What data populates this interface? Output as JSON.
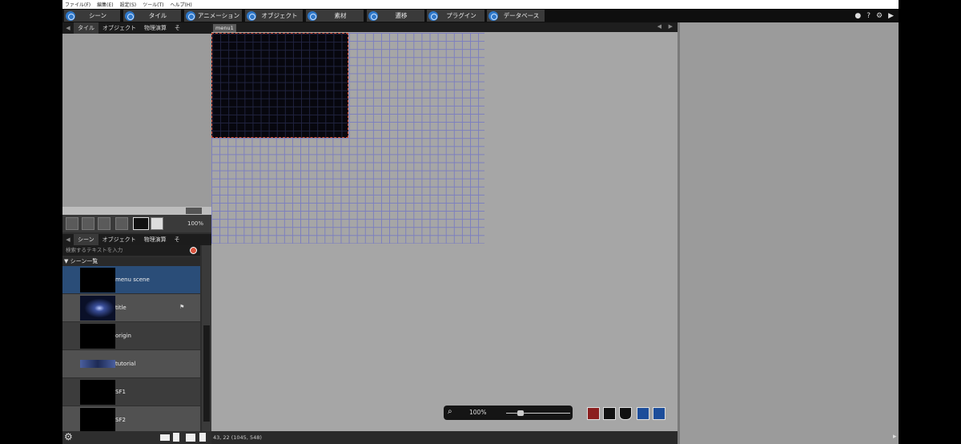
{
  "menu": [
    "ファイル(F)",
    "編集(E)",
    "設定(S)",
    "ツール(T)",
    "ヘルプ(H)"
  ],
  "main_tabs": [
    {
      "label": "シーン",
      "icon": "scene-icon"
    },
    {
      "label": "タイル",
      "icon": "tile-icon"
    },
    {
      "label": "アニメーション",
      "icon": "animation-icon"
    },
    {
      "label": "オブジェクト",
      "icon": "object-icon"
    },
    {
      "label": "素材",
      "icon": "resource-icon"
    },
    {
      "label": "遷移",
      "icon": "transition-icon"
    },
    {
      "label": "プラグイン",
      "icon": "plugin-icon"
    },
    {
      "label": "データベース",
      "icon": "database-icon"
    }
  ],
  "top_right": {
    "help": "?",
    "play": "▶"
  },
  "upper_tabs": [
    "タイル",
    "オブジェクト",
    "物理演算",
    "そ"
  ],
  "zoom_tiles": "100%",
  "lower_tabs": [
    "シーン",
    "オブジェクト",
    "物理演算",
    "そ"
  ],
  "search_placeholder": "検索するテキストを入力",
  "scene_list_title": "シーン一覧",
  "scenes": [
    {
      "name": "menu scene",
      "selected": true
    },
    {
      "name": "title",
      "selected": false
    },
    {
      "name": "origin",
      "selected": false
    },
    {
      "name": "tutorial",
      "selected": false
    },
    {
      "name": "SF1",
      "selected": false
    },
    {
      "name": "SF2",
      "selected": false
    }
  ],
  "canvas_tab": "menu1",
  "canvas_zoom": "100%",
  "status": "43, 22 (1045, 548)",
  "colors": {
    "accent": "#2f78c9",
    "selected_row": "#2a4d78",
    "grid": "#7c7fbf",
    "selection_border": "#d64a2a"
  }
}
